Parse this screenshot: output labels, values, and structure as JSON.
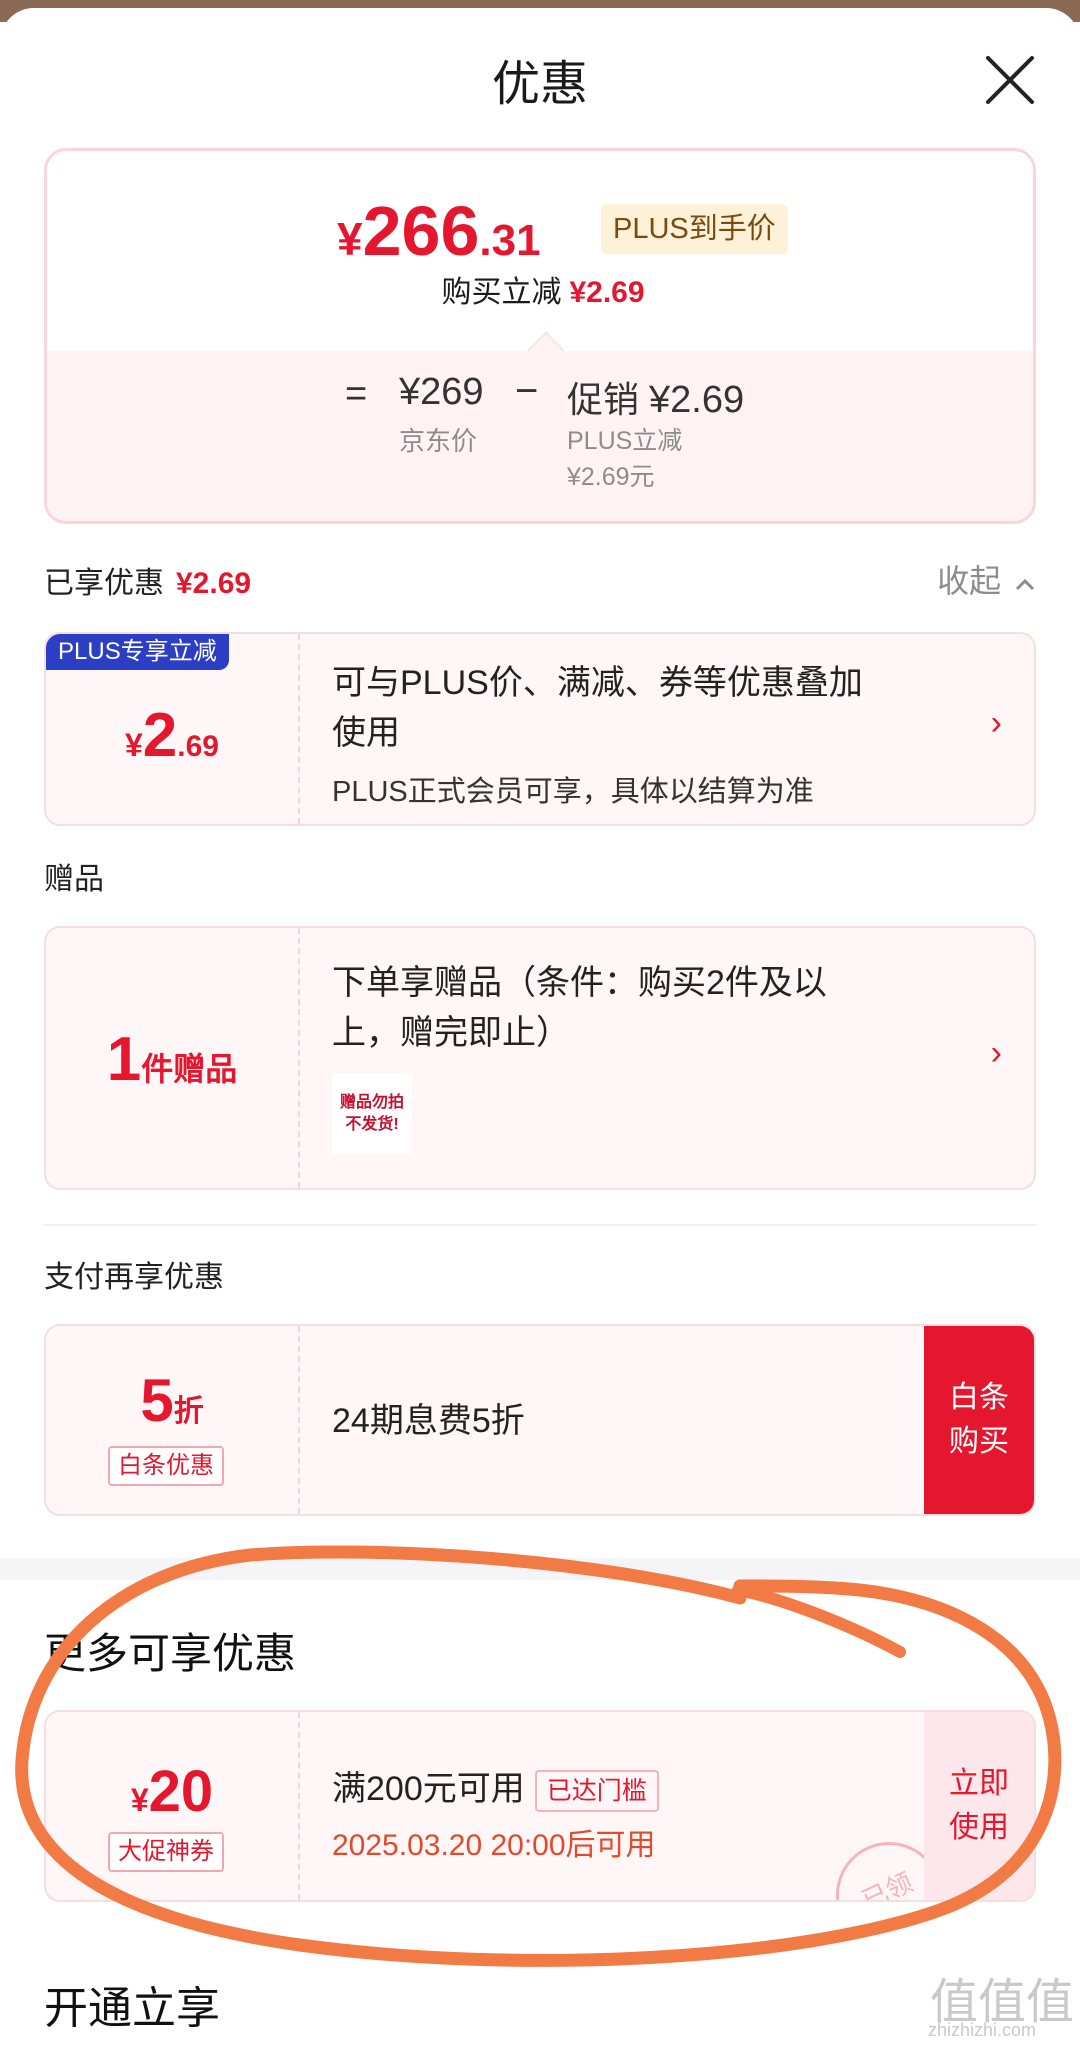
{
  "header": {
    "title": "优惠"
  },
  "summary": {
    "price_yen": "¥",
    "price_int": "266",
    "price_dec": ".31",
    "plus_tag": "PLUS到手价",
    "reduce_label": "购买立减",
    "reduce_value": "¥2.69",
    "eq": "=",
    "jd_price": "¥269",
    "jd_label": "京东价",
    "minus": "−",
    "promo_label": "促销",
    "promo_value": "¥2.69",
    "promo_sub1": "PLUS立减",
    "promo_sub2": "¥2.69元"
  },
  "enjoyed": {
    "label": "已享优惠",
    "value": "¥2.69",
    "collapse": "收起"
  },
  "plus_card": {
    "badge": "PLUS专享立减",
    "yen": "¥",
    "int": "2",
    "dec": ".69",
    "line1": "可与PLUS价、满减、券等优惠叠加",
    "line2": "使用",
    "sub": "PLUS正式会员可享，具体以结算为准"
  },
  "gift_section": {
    "label": "赠品"
  },
  "gift_card": {
    "num": "1",
    "unit": "件赠品",
    "line1": "下单享赠品（条件：购买2件及以",
    "line2": "上，赠完即止）",
    "thumb_line1": "赠品勿拍",
    "thumb_line2": "不发货!"
  },
  "pay_section": {
    "label": "支付再享优惠"
  },
  "pay_card": {
    "num": "5",
    "unit": "折",
    "tag": "白条优惠",
    "desc": "24期息费5折",
    "btn_line1": "白条",
    "btn_line2": "购买"
  },
  "more_section": {
    "label": "更多可享优惠"
  },
  "coupon_card": {
    "yen": "¥",
    "num": "20",
    "tag": "大促神券",
    "desc": "满200元可用",
    "chip": "已达门槛",
    "date": "2025.03.20 20:00后可用",
    "btn_line1": "立即",
    "btn_line2": "使用",
    "stamp": "已领"
  },
  "bottom_section": {
    "label": "开通立享"
  },
  "watermark": {
    "mark": "值值值",
    "site": "zhizhizhi.com"
  },
  "colors": {
    "accent_red": "#e4172f",
    "plus_blue": "#2c3fc4",
    "annotation_orange": "#f27a45"
  }
}
